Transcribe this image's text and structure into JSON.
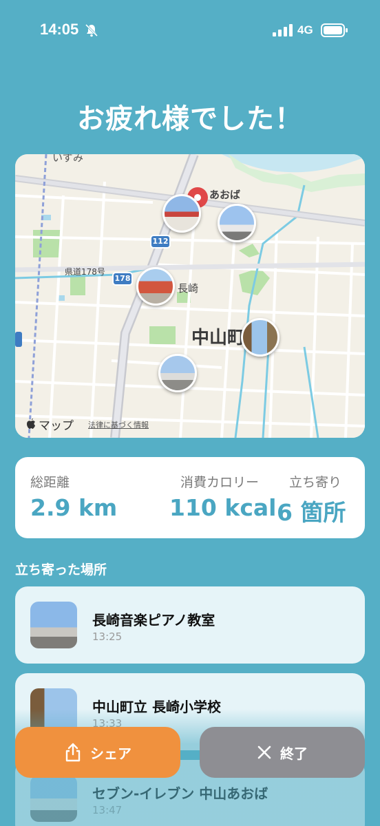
{
  "status_bar": {
    "time": "14:05",
    "network": "4G"
  },
  "page_title": "お疲れ様でした！",
  "map": {
    "labels": {
      "aoba": "あおば",
      "nagasaki": "長崎",
      "town": "中山町",
      "prefectural_road": "県道178号",
      "top_cut": "いずみ"
    },
    "route_shields": [
      "112",
      "178"
    ],
    "attribution": "マップ",
    "legal": "法律に基づく情報"
  },
  "stats": {
    "distance": {
      "label": "総距離",
      "value": "2.9 km"
    },
    "calories": {
      "label": "消費カロリー",
      "value": "110 kcal"
    },
    "stops": {
      "label": "立ち寄り",
      "value": "6 箇所"
    }
  },
  "section_title": "立ち寄った場所",
  "places": [
    {
      "name": "長崎音楽ピアノ教室",
      "time": "13:25"
    },
    {
      "name": "中山町立 長崎小学校",
      "time": "13:33"
    },
    {
      "name": "セブン-イレブン 中山あおば",
      "time": "13:47"
    }
  ],
  "actions": {
    "share": "シェア",
    "end": "終了"
  }
}
